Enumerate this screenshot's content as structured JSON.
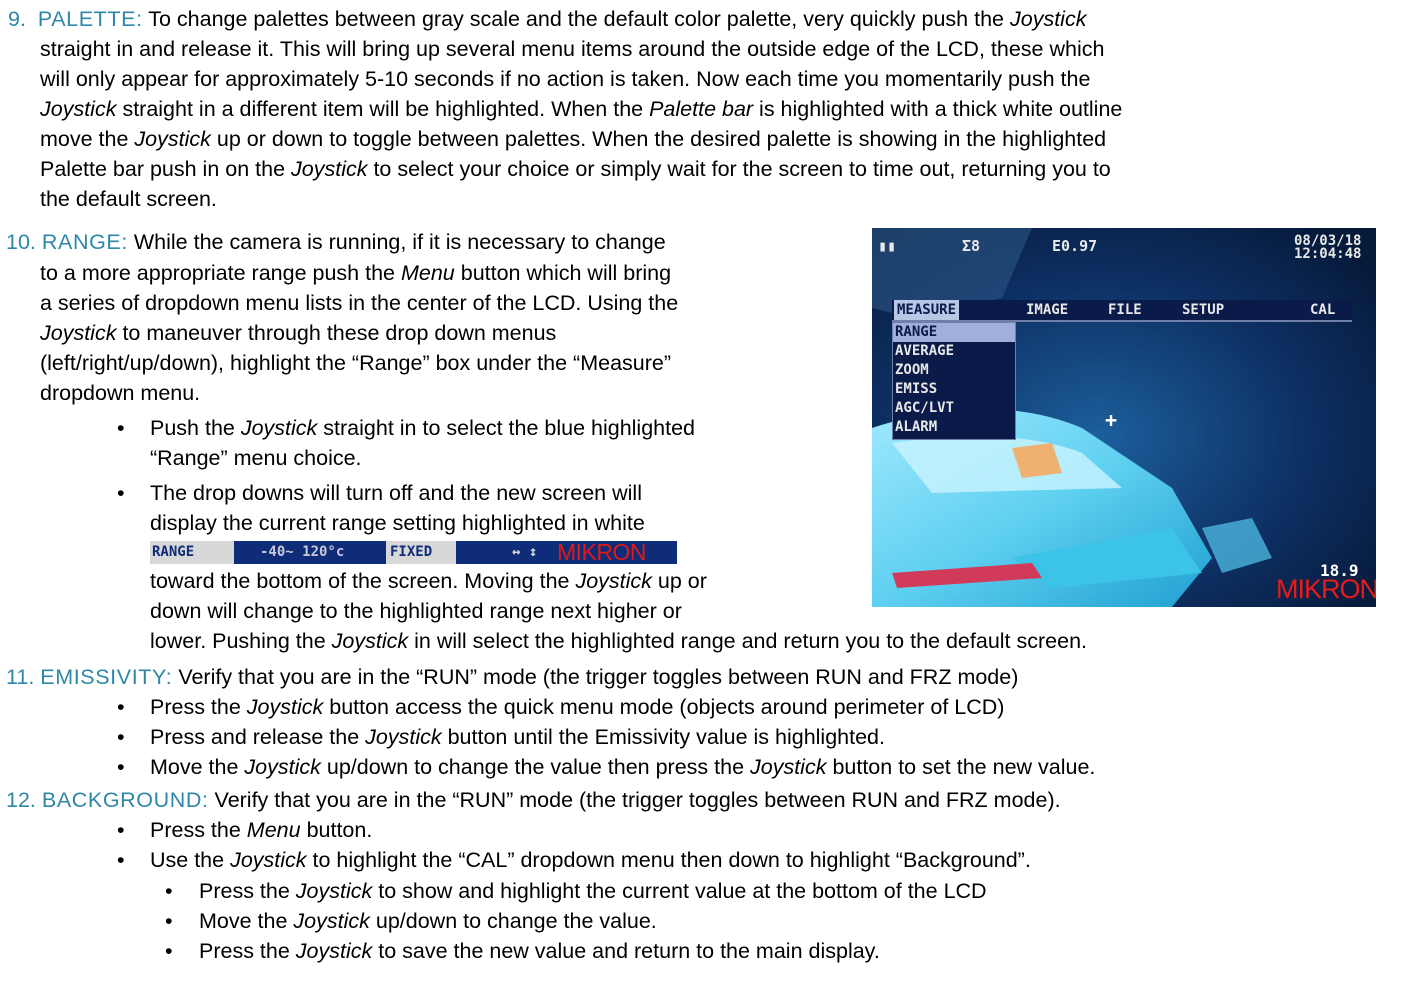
{
  "section9": {
    "number": "9.",
    "heading": "PALETTE:",
    "lines": [
      {
        "a": " To change palettes between gray scale and the default color palette, very quickly push the ",
        "i": "Joystick",
        "b": ""
      },
      {
        "a": "straight in and release it.  This will bring up several menu items around the outside edge of the LCD, these which",
        "i": "",
        "b": ""
      },
      {
        "a": "will only appear for approximately 5-10 seconds if no action is taken. Now each time you momentarily push the",
        "i": "",
        "b": ""
      },
      {
        "a": "",
        "i": "Joystick",
        "b": " straight in a different item will be highlighted. When the "
      },
      {
        "a": "move the ",
        "i": "Joystick",
        "b": " up or down to toggle between palettes. When the desired palette is showing in the highlighted"
      },
      {
        "a": "Palette bar push in on the ",
        "i": "Joystick",
        "b": " to select your choice or simply wait for the screen to time out, returning you to"
      },
      {
        "a": "the default screen.",
        "i": "",
        "b": ""
      }
    ],
    "line4_i2": "Palette bar",
    "line4_tail": " is highlighted with a thick white outline"
  },
  "section10": {
    "number": "10.",
    "heading": "RANGE:",
    "line1": " While the camera is running, if it is necessary to change",
    "line2a": "to a more appropriate range push the ",
    "line2i": "Menu",
    "line2b": " button which will bring",
    "line3": "a series of dropdown menu lists in the center of the LCD. Using the",
    "line4i": "Joystick",
    "line4b": " to maneuver through these drop down menus",
    "line5": "(left/right/up/down), highlight the “Range” box under the “Measure”",
    "line6": "dropdown menu.",
    "bullet1a": "Push the ",
    "bullet1i": "Joystick",
    "bullet1b": " straight in to select the blue highlighted",
    "bullet1c": "“Range” menu choice.",
    "bullet2a": "The drop downs will turn off and the new screen will",
    "bullet2b": "display the current range setting highlighted in white",
    "bullet2c": "toward the bottom of the screen. Moving the ",
    "bullet2ci": "Joystick",
    "bullet2cb": " up or",
    "bullet2d": "down will change to the highlighted range next higher or",
    "bullet2e": "lower. Pushing the ",
    "bullet2ei": "Joystick",
    "bullet2eb": " in will select the highlighted range and return you to the default screen."
  },
  "rangebar": {
    "label": "RANGE",
    "value": "-40~ 120°c",
    "mode": "FIXED",
    "arrows": "↔ ↕",
    "brand": "MIKRON"
  },
  "lcd": {
    "battery": "▮▮",
    "sigma": "Σ8",
    "emissivity": "E0.97",
    "date": "08/03/18",
    "time": "12:04:48",
    "menu": [
      "MEASURE",
      "IMAGE",
      "FILE",
      "SETUP",
      "CAL"
    ],
    "dropdown": [
      "RANGE",
      "AVERAGE",
      "ZOOM",
      "EMISS",
      "AGC/LVT",
      "ALARM"
    ],
    "crosshair": "+",
    "temp": "18.9",
    "brand": "MIKRON"
  },
  "section11": {
    "number": "11.",
    "heading": "EMISSIVITY:",
    "line1": " Verify that you are in the “RUN” mode (the trigger toggles between RUN and FRZ mode)",
    "b1a": "Press the ",
    "b1i": "Joystick",
    "b1b": " button access the quick menu mode (objects around perimeter of LCD)",
    "b2a": "Press and release the ",
    "b2i": "Joystick",
    "b2b": " button until the Emissivity value is highlighted.",
    "b3a": "Move the ",
    "b3i": "Joystick",
    "b3b": " up/down to change the value then press the ",
    "b3i2": "Joystick",
    "b3c": " button to set the new value."
  },
  "section12": {
    "number": "12.",
    "heading": "BACKGROUND:",
    "line1": " Verify that you are in the “RUN” mode (the trigger toggles between RUN and FRZ mode).",
    "b1a": "Press the ",
    "b1i": "Menu",
    "b1b": " button.",
    "b2a": "Use the ",
    "b2i": "Joystick",
    "b2b": " to highlight the “CAL” dropdown menu then down to highlight “Background”.",
    "s1a": "Press the ",
    "s1i": "Joystick",
    "s1b": " to show and highlight the current value at the bottom of the LCD",
    "s2a": "Move the ",
    "s2i": "Joystick",
    "s2b": " up/down to change the value.",
    "s3a": "Press the ",
    "s3i": "Joystick",
    "s3b": " to save the new value and return to the main display."
  },
  "bullet_glyph": "•"
}
